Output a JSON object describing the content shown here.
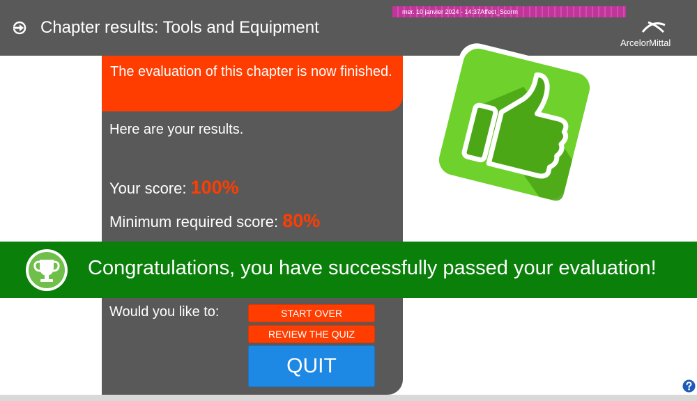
{
  "header": {
    "title": "Chapter results: Tools and Equipment",
    "timestamp": "mer. 10 janvier 2024 - 14:37Affect_Scorm",
    "logo_text": "ArcelorMittal",
    "arrow_icon": "arrow-right-circle-icon",
    "logo_icon": "arcelormittal-logo-icon"
  },
  "results": {
    "finished_message": "The evaluation of this chapter is now finished.",
    "intro": "Here are your results.",
    "your_score_label": "Your score:",
    "your_score_value": "100%",
    "min_score_label": "Minimum required score:",
    "min_score_value": "80%"
  },
  "illustration": {
    "icon": "thumbs-up-icon"
  },
  "banner": {
    "icon": "trophy-icon",
    "message": "Congratulations, you have successfully passed your evaluation!"
  },
  "actions": {
    "prompt": "Would you like to:",
    "start_over": "START OVER",
    "review_quiz": "REVIEW THE QUIZ",
    "quit": "QUIT"
  },
  "help": {
    "icon": "help-icon"
  },
  "colors": {
    "header_bg": "#595959",
    "accent_orange": "#ff3d00",
    "success_green": "#0a7f0a",
    "thumb_green": "#6fd12b",
    "quit_blue": "#1e88e5",
    "timestamp_magenta": "#c1359a"
  }
}
